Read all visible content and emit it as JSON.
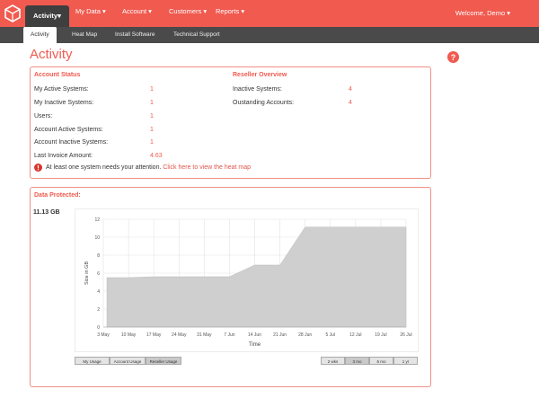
{
  "nav": {
    "items": [
      {
        "label": "Activity▾"
      },
      {
        "label": "My Data ▾"
      },
      {
        "label": "Account ▾"
      },
      {
        "label": "Customers ▾"
      },
      {
        "label": "Reports ▾"
      }
    ],
    "welcome": "Welcome, Demo ▾"
  },
  "subnav": {
    "tabs": [
      {
        "label": "Activity"
      },
      {
        "label": "Heat Map"
      },
      {
        "label": "Install Software"
      },
      {
        "label": "Technical Support"
      }
    ]
  },
  "page": {
    "title": "Activity"
  },
  "account_status": {
    "heading": "Account Status",
    "rows": [
      {
        "label": "My Active Systems:",
        "value": "1"
      },
      {
        "label": "My Inactive Systems:",
        "value": "1"
      },
      {
        "label": "Users:",
        "value": "1"
      },
      {
        "label": "Account Active Systems:",
        "value": "1"
      },
      {
        "label": "Account Inactive Systems:",
        "value": "1"
      },
      {
        "label": "Last Invoice Amount:",
        "value": "4.63"
      }
    ],
    "alert_text": "At least one system needs your attention.",
    "alert_link": "Click here to view the heat map"
  },
  "reseller_overview": {
    "heading": "Reseller Overview",
    "rows": [
      {
        "label": "Inactive Systems:",
        "value": "4"
      },
      {
        "label": "Oustanding Accounts:",
        "value": "4"
      }
    ]
  },
  "data_protected": {
    "heading": "Data Protected:",
    "amount": "11.13 GB",
    "usage_buttons": [
      {
        "label": "My Usage",
        "selected": false
      },
      {
        "label": "Account Usage",
        "selected": false
      },
      {
        "label": "Reseller Usage",
        "selected": true
      }
    ],
    "range_buttons": [
      {
        "label": "2 wks",
        "selected": false
      },
      {
        "label": "3 mo",
        "selected": true
      },
      {
        "label": "6 mo",
        "selected": false
      },
      {
        "label": "1 yr",
        "selected": false
      }
    ]
  },
  "chart_data": {
    "type": "area",
    "title": "",
    "xlabel": "Time",
    "ylabel": "Size in GB",
    "ylim": [
      0,
      12
    ],
    "yticks": [
      0,
      2,
      4,
      6,
      8,
      10,
      12
    ],
    "xtick_labels": [
      "3 May",
      "10 May",
      "17 May",
      "24 May",
      "31 May",
      "7 Jun",
      "14 Jun",
      "21 Jun",
      "28 Jun",
      "5 Jul",
      "12 Jul",
      "19 Jul",
      "26 Jul"
    ],
    "x_start": "3 May",
    "x_end": "26 Jul",
    "grid": true,
    "fill_color": "#cfcfcf",
    "series": [
      {
        "x": [
          "4 May",
          "10 May",
          "17 May",
          "24 May",
          "31 May",
          "7 Jun",
          "14 Jun",
          "21 Jun",
          "28 Jun",
          "5 Jul",
          "12 Jul",
          "19 Jul",
          "26 Jul"
        ],
        "values": [
          5.5,
          5.5,
          5.6,
          5.6,
          5.6,
          5.6,
          6.9,
          6.9,
          11.13,
          11.13,
          11.13,
          11.13,
          11.13
        ]
      }
    ]
  },
  "colors": {
    "brand": "#f05a4f",
    "subnav": "#4a4a4a",
    "active_tab": "#3f3f3f"
  }
}
